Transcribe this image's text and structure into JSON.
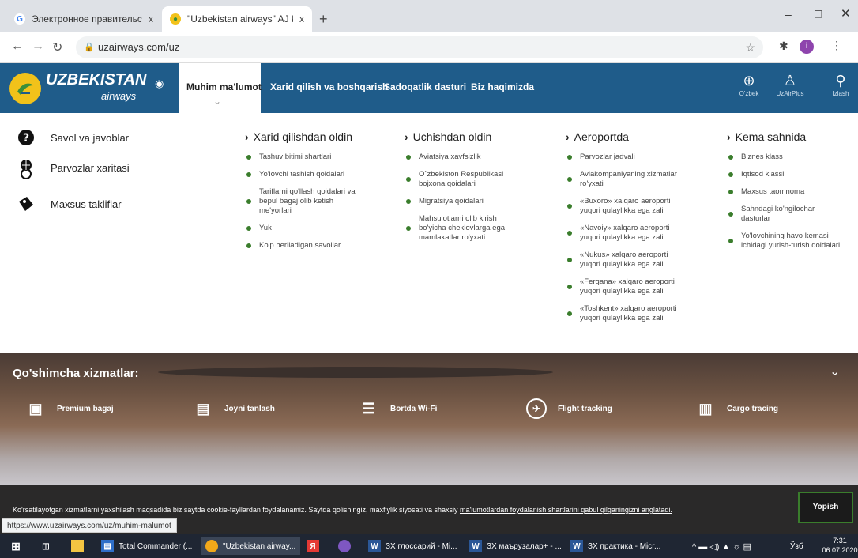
{
  "browser": {
    "tabs": [
      {
        "title": "Электронное правительство Ю..."
      },
      {
        "title": "\"Uzbekistan airways\" AJ korporat..."
      }
    ],
    "new_tab": "+",
    "close": "x",
    "url": "uzairways.com/uz",
    "status_url": "https://www.uzairways.com/uz/muhim-malumot"
  },
  "site": {
    "logo_main": "UZBEKISTAN",
    "logo_sub": "airways",
    "nav": [
      {
        "label": "Muhim ma'lumot"
      },
      {
        "label": "Xarid qilish va boshqarish"
      },
      {
        "label": "Sadoqatlik dasturi"
      },
      {
        "label": "Biz haqimizda"
      }
    ],
    "right_nav": [
      {
        "label": "O'zbek"
      },
      {
        "label": "UzAirPlus"
      },
      {
        "label": "Izlash"
      }
    ]
  },
  "quick_links": [
    {
      "label": "Savol va javoblar"
    },
    {
      "label": "Parvozlar xaritasi"
    },
    {
      "label": "Maxsus takliflar"
    }
  ],
  "columns": [
    {
      "title": "Xarid qilishdan oldin",
      "items": [
        "Tashuv bitimi shartlari",
        "Yo'lovchi tashish qoidalari",
        "Tariflarni qo'llash qoidalari va bepul bagaj olib ketish me'yorlari",
        "Yuk",
        "Ko'p beriladigan savollar"
      ]
    },
    {
      "title": "Uchishdan oldin",
      "items": [
        "Aviatsiya xavfsizlik",
        "O`zbekiston Respublikasi bojxona qoidalari",
        "Migratsiya qoidalari",
        "Mahsulotlarni olib kirish bo'yicha cheklovlarga ega mamlakatlar ro'yxati"
      ]
    },
    {
      "title": "Aeroportda",
      "items": [
        "Parvozlar jadvali",
        "Aviakompaniyaning xizmatlar ro'yxati",
        "«Buxoro» xalqaro aeroporti yuqori qulaylikka ega zali",
        "«Navoiy» xalqaro aeroporti yuqori qulaylikka ega zali",
        "«Nukus» xalqaro aeroporti yuqori qulaylikka ega zali",
        "«Fergana» xalqaro aeroporti yuqori qulaylikka ega zali",
        "«Toshkent» xalqaro aeroporti yuqori qulaylikka ega zali"
      ]
    },
    {
      "title": "Kema sahnida",
      "items": [
        "Biznes klass",
        "Iqtisod klassi",
        "Maxsus taomnoma",
        "Sahndagi ko'ngilochar dasturlar",
        "Yo'lovchining havo kemasi ichidagi yurish-turish qoidalari"
      ]
    }
  ],
  "services": {
    "title": "Qo'shimcha xizmatlar:",
    "items": [
      {
        "label": "Premium bagaj"
      },
      {
        "label": "Joyni tanlash"
      },
      {
        "label": "Bortda Wi-Fi"
      },
      {
        "label": "Flight tracking"
      },
      {
        "label": "Cargo tracing"
      }
    ]
  },
  "cookie": {
    "text": "Ko'rsatilayotgan xizmatlarni yaxshilash maqsadida biz saytda cookie-fayllardan foydalanamiz. Saytda qolishingiz, maxfiylik siyosati va shaxsiy",
    "link": "ma'lumotlardan foydalanish shartlarini qabul qilganingizni anglatadi.",
    "button": "Yopish"
  },
  "taskbar": {
    "apps": [
      {
        "label": "Total Commander (..."
      },
      {
        "label": "\"Uzbekistan airway..."
      },
      {
        "label": "ЗХ глоссарий - Mi..."
      },
      {
        "label": "ЗХ маърузалар+ - ..."
      },
      {
        "label": "ЗХ практика - Micr..."
      }
    ],
    "lang": "Ўзб",
    "time": "7:31",
    "date": "06.07.2020"
  },
  "colors": {
    "nav_bg": "#1f5c8a",
    "bullet": "#3a7d2c",
    "logo_yellow": "#f2c21a",
    "logo_green": "#3a8f3a"
  }
}
